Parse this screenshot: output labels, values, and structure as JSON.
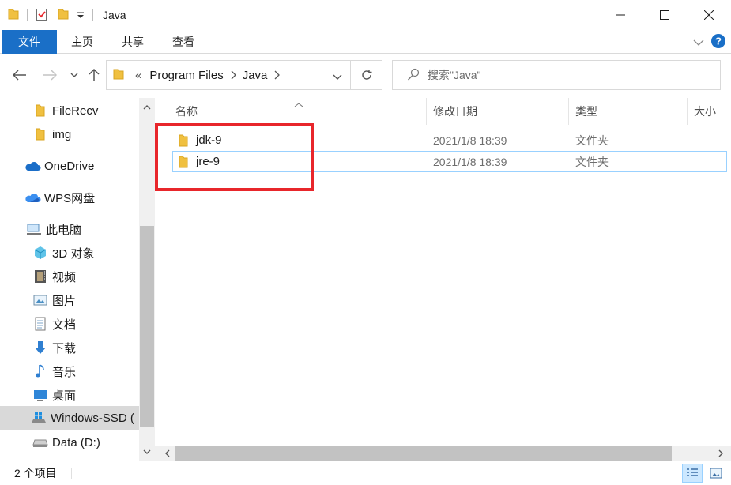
{
  "window": {
    "title": "Java"
  },
  "ribbon": {
    "tabs": [
      "文件",
      "主页",
      "共享",
      "查看"
    ]
  },
  "address": {
    "overflow": "«",
    "crumbs": [
      "Program Files",
      "Java"
    ]
  },
  "search": {
    "placeholder": "搜索\"Java\""
  },
  "nav": {
    "items": [
      {
        "label": "FileRecv",
        "icon": "folder-icon"
      },
      {
        "label": "img",
        "icon": "folder-icon"
      },
      {
        "label": "OneDrive",
        "icon": "onedrive-cloud-icon"
      },
      {
        "label": "WPS网盘",
        "icon": "wps-cloud-icon"
      },
      {
        "label": "此电脑",
        "icon": "computer-icon"
      },
      {
        "label": "3D 对象",
        "icon": "3d-objects-icon"
      },
      {
        "label": "视频",
        "icon": "video-icon"
      },
      {
        "label": "图片",
        "icon": "pictures-icon"
      },
      {
        "label": "文档",
        "icon": "documents-icon"
      },
      {
        "label": "下载",
        "icon": "download-icon"
      },
      {
        "label": "音乐",
        "icon": "music-icon"
      },
      {
        "label": "桌面",
        "icon": "desktop-icon"
      },
      {
        "label": "Windows-SSD (",
        "icon": "windows-drive-icon",
        "selected": true
      },
      {
        "label": "Data (D:)",
        "icon": "drive-icon"
      }
    ]
  },
  "columns": {
    "name": "名称",
    "modified": "修改日期",
    "type": "类型",
    "size": "大小"
  },
  "files": [
    {
      "name": "jdk-9",
      "modified": "2021/1/8 18:39",
      "type": "文件夹"
    },
    {
      "name": "jre-9",
      "modified": "2021/1/8 18:39",
      "type": "文件夹"
    }
  ],
  "status": {
    "count": "2 个项目"
  },
  "colors": {
    "accent": "#1a6fc7",
    "highlight": "#e8262b",
    "folder": "#f0c040",
    "selection": "#d9d9d9"
  }
}
